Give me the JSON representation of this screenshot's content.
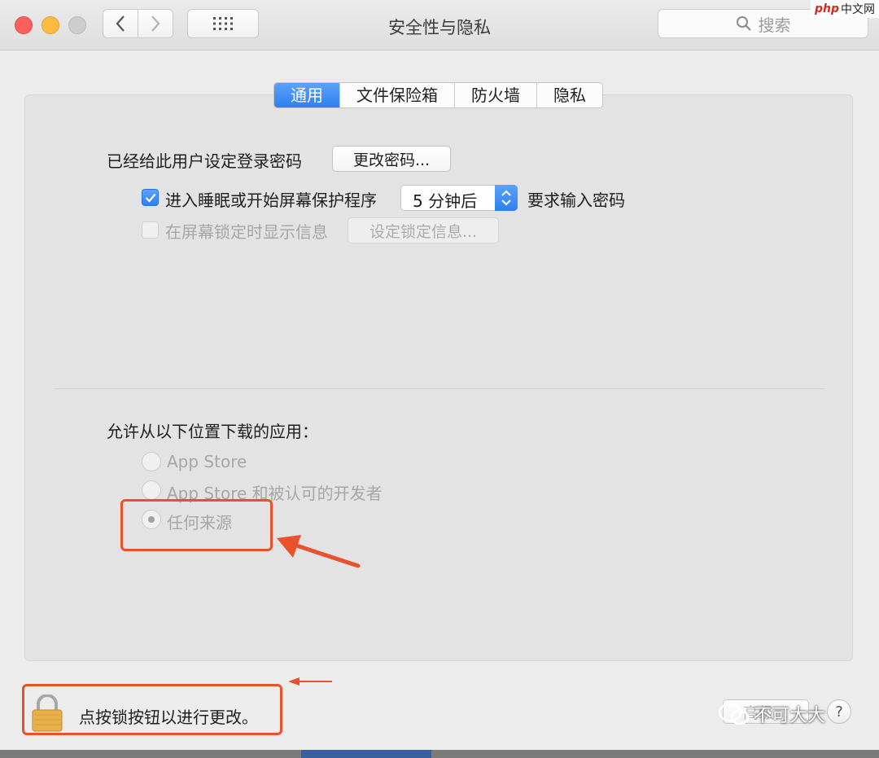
{
  "window": {
    "title": "安全性与隐私",
    "search_placeholder": "搜索"
  },
  "watermark": {
    "php": "php",
    "cn": "中文网"
  },
  "tabs": [
    {
      "label": "通用",
      "active": true
    },
    {
      "label": "文件保险箱",
      "active": false
    },
    {
      "label": "防火墙",
      "active": false
    },
    {
      "label": "隐私",
      "active": false
    }
  ],
  "general": {
    "password_label": "已经给此用户设定登录密码",
    "change_password_button": "更改密码...",
    "require_password": {
      "checked": true,
      "label": "进入睡眠或开始屏幕保护程序",
      "delay_value": "5 分钟后",
      "suffix": "要求输入密码"
    },
    "lock_message": {
      "checked": false,
      "label": "在屏幕锁定时显示信息",
      "button": "设定锁定信息..."
    }
  },
  "downloads": {
    "heading": "允许从以下位置下载的应用：",
    "options": [
      {
        "label": "App Store",
        "selected": false
      },
      {
        "label": "App Store 和被认可的开发者",
        "selected": false
      },
      {
        "label": "任何来源",
        "selected": true
      }
    ]
  },
  "footer": {
    "lock_text": "点按锁按钮以进行更改。",
    "advanced_button": "高级...",
    "help_button": "?",
    "wechat_watermark": "不可大大"
  },
  "colors": {
    "accent": "#2f7ff2",
    "annotation": "#e8512b"
  }
}
